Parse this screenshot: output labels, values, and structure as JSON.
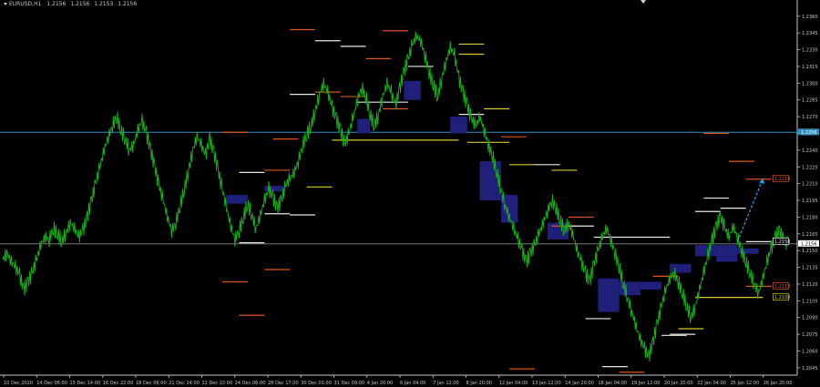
{
  "header": {
    "symbol": "EURUSD,H1",
    "ohlc": [
      "1.2156",
      "1.2156",
      "1.2153",
      "1.2156"
    ]
  },
  "colors": {
    "background": "#000000",
    "price_line": "#17b217",
    "axis_text": "#c8c8c8",
    "zone_fill": "#20207a",
    "level_orange": "#e0531a",
    "level_white": "#e8e8e8",
    "level_yellow": "#d8c828",
    "horizontal_blue": "#2d8fc4",
    "projection": "#2d9ce0"
  },
  "chart_data": {
    "type": "line",
    "series": [
      {
        "values": [
          1.2142,
          1.2148,
          1.214,
          1.2135,
          1.2128,
          1.2115,
          1.2122,
          1.213,
          1.2142,
          1.2155,
          1.2162,
          1.216,
          1.217,
          1.2165,
          1.2158,
          1.2166,
          1.2175,
          1.217,
          1.2162,
          1.2168,
          1.218,
          1.2195,
          1.221,
          1.2225,
          1.224,
          1.2252,
          1.2262,
          1.227,
          1.2258,
          1.225,
          1.224,
          1.2245,
          1.2258,
          1.2266,
          1.2255,
          1.224,
          1.2225,
          1.2208,
          1.2195,
          1.218,
          1.2168,
          1.2175,
          1.219,
          1.2205,
          1.2222,
          1.224,
          1.2252,
          1.2245,
          1.2235,
          1.225,
          1.2238,
          1.2222,
          1.2205,
          1.2188,
          1.2172,
          1.216,
          1.2168,
          1.218,
          1.2192,
          1.2182,
          1.217,
          1.2182,
          1.2195,
          1.2205,
          1.2198,
          1.2188,
          1.2195,
          1.2208,
          1.2215,
          1.222,
          1.223,
          1.2244,
          1.2254,
          1.2262,
          1.2275,
          1.229,
          1.23,
          1.2292,
          1.2278,
          1.2268,
          1.2258,
          1.2245,
          1.2255,
          1.227,
          1.2285,
          1.2296,
          1.2288,
          1.2272,
          1.2262,
          1.2272,
          1.2288,
          1.23,
          1.2292,
          1.228,
          1.2295,
          1.231,
          1.2322,
          1.2335,
          1.2342,
          1.2338,
          1.2325,
          1.231,
          1.2298,
          1.2288,
          1.2305,
          1.232,
          1.2332,
          1.2325,
          1.2305,
          1.2292,
          1.228,
          1.2268,
          1.2262,
          1.227,
          1.2258,
          1.2245,
          1.2235,
          1.222,
          1.2205,
          1.219,
          1.218,
          1.217,
          1.216,
          1.215,
          1.214,
          1.2148,
          1.2155,
          1.2165,
          1.2175,
          1.2185,
          1.2195,
          1.2188,
          1.2178,
          1.2168,
          1.2175,
          1.2165,
          1.215,
          1.214,
          1.213,
          1.2122,
          1.2138,
          1.215,
          1.2162,
          1.217,
          1.216,
          1.2148,
          1.2135,
          1.212,
          1.2108,
          1.2095,
          1.2082,
          1.207,
          1.2062,
          1.2055,
          1.2068,
          1.2085,
          1.21,
          1.2115,
          1.2125,
          1.213,
          1.2122,
          1.2112,
          1.21,
          1.209,
          1.21,
          1.2115,
          1.213,
          1.2145,
          1.216,
          1.2172,
          1.218,
          1.217,
          1.2162,
          1.2172,
          1.2162,
          1.215,
          1.214,
          1.213,
          1.212,
          1.2112,
          1.2125,
          1.214,
          1.2152,
          1.2162,
          1.2168,
          1.2158,
          1.2156
        ]
      }
    ],
    "x_labels": [
      "10 Dec 2020",
      "14 Dec 06:00",
      "15 Dec 14:00",
      "16 Dec 22:00",
      "18 Dec 06:00",
      "21 Dec 14:00",
      "22 Dec 22:00",
      "24 Dec 06:00",
      "28 Dec 17:00",
      "30 Dec 01:00",
      "31 Dec 09:00",
      "4 Jan 20:00",
      "6 Jan 04:00",
      "7 Jan 12:00",
      "8 Jan 20:00",
      "12 Jan 04:00",
      "13 Jan 12:00",
      "14 Jan 20:00",
      "18 Jan 04:00",
      "19 Jan 12:00",
      "20 Jan 20:00",
      "22 Jan 04:00",
      "25 Jan 12:00",
      "26 Jan 20:00"
    ],
    "y_ticks": [
      "1.2360",
      "1.2345",
      "1.2330",
      "1.2315",
      "1.2300",
      "1.2285",
      "1.2270",
      "1.2255",
      "1.2240",
      "1.2225",
      "1.2210",
      "1.2195",
      "1.2180",
      "1.2165",
      "1.2150",
      "1.2135",
      "1.2120",
      "1.2105",
      "1.2090",
      "1.2075",
      "1.2060",
      "1.2045"
    ],
    "ylim": [
      1.204,
      1.2368
    ],
    "grid": false,
    "current_price": "1.2156",
    "blue_level": "1.2256",
    "right_labels": [
      {
        "text": "1.2214",
        "value": 1.2214,
        "color": "#e0531a"
      },
      {
        "text": "1.2158",
        "value": 1.2158,
        "color": "#e8e8e8"
      },
      {
        "text": "1.2118",
        "value": 1.2118,
        "color": "#e0531a"
      },
      {
        "text": "1.2108",
        "value": 1.2108,
        "color": "#d8c828"
      }
    ],
    "zones": [
      {
        "i0": 53,
        "i1": 58,
        "lo": 1.2192,
        "hi": 1.22
      },
      {
        "i0": 62,
        "i1": 67,
        "lo": 1.2203,
        "hi": 1.2208
      },
      {
        "i0": 84,
        "i1": 87,
        "lo": 1.2255,
        "hi": 1.2268
      },
      {
        "i0": 95,
        "i1": 99,
        "lo": 1.2285,
        "hi": 1.2302
      },
      {
        "i0": 106,
        "i1": 110,
        "lo": 1.2255,
        "hi": 1.227
      },
      {
        "i0": 113,
        "i1": 118,
        "lo": 1.2195,
        "hi": 1.223
      },
      {
        "i0": 118,
        "i1": 122,
        "lo": 1.2175,
        "hi": 1.22
      },
      {
        "i0": 129,
        "i1": 134,
        "lo": 1.216,
        "hi": 1.2175
      },
      {
        "i0": 141,
        "i1": 146,
        "lo": 1.2095,
        "hi": 1.2125
      },
      {
        "i0": 146,
        "i1": 151,
        "lo": 1.211,
        "hi": 1.2122
      },
      {
        "i0": 151,
        "i1": 156,
        "lo": 1.2115,
        "hi": 1.2122
      },
      {
        "i0": 158,
        "i1": 163,
        "lo": 1.213,
        "hi": 1.2138
      },
      {
        "i0": 164,
        "i1": 169,
        "lo": 1.2145,
        "hi": 1.2155
      },
      {
        "i0": 169,
        "i1": 174,
        "lo": 1.214,
        "hi": 1.2155
      },
      {
        "i0": 174,
        "i1": 179,
        "lo": 1.2147,
        "hi": 1.2152
      }
    ],
    "levels": [
      {
        "i0": 68,
        "i1": 74,
        "v": 1.2348,
        "c": "o"
      },
      {
        "i0": 74,
        "i1": 80,
        "v": 1.2338,
        "c": "w"
      },
      {
        "i0": 80,
        "i1": 86,
        "v": 1.2333,
        "c": "w"
      },
      {
        "i0": 86,
        "i1": 92,
        "v": 1.2322,
        "c": "o"
      },
      {
        "i0": 90,
        "i1": 96,
        "v": 1.2347,
        "c": "o"
      },
      {
        "i0": 96,
        "i1": 102,
        "v": 1.2315,
        "c": "w"
      },
      {
        "i0": 108,
        "i1": 114,
        "v": 1.2335,
        "c": "y"
      },
      {
        "i0": 108,
        "i1": 114,
        "v": 1.2326,
        "c": "y"
      },
      {
        "i0": 68,
        "i1": 74,
        "v": 1.229,
        "c": "w"
      },
      {
        "i0": 74,
        "i1": 80,
        "v": 1.2292,
        "c": "o"
      },
      {
        "i0": 80,
        "i1": 86,
        "v": 1.2288,
        "c": "o"
      },
      {
        "i0": 84,
        "i1": 90,
        "v": 1.2283,
        "c": "w"
      },
      {
        "i0": 90,
        "i1": 96,
        "v": 1.2283,
        "c": "w"
      },
      {
        "i0": 90,
        "i1": 96,
        "v": 1.2277,
        "c": "o"
      },
      {
        "i0": 108,
        "i1": 114,
        "v": 1.2272,
        "c": "w"
      },
      {
        "i0": 114,
        "i1": 120,
        "v": 1.2277,
        "c": "y"
      },
      {
        "i0": 52,
        "i1": 58,
        "v": 1.2256,
        "c": "o"
      },
      {
        "i0": 64,
        "i1": 70,
        "v": 1.225,
        "c": "o"
      },
      {
        "i0": 78,
        "i1": 96,
        "v": 1.2249,
        "c": "y"
      },
      {
        "i0": 96,
        "i1": 108,
        "v": 1.2249,
        "c": "y"
      },
      {
        "i0": 110,
        "i1": 120,
        "v": 1.2247,
        "c": "y"
      },
      {
        "i0": 118,
        "i1": 124,
        "v": 1.2252,
        "c": "o"
      },
      {
        "i0": 120,
        "i1": 126,
        "v": 1.2227,
        "c": "y"
      },
      {
        "i0": 126,
        "i1": 132,
        "v": 1.2227,
        "c": "w"
      },
      {
        "i0": 130,
        "i1": 136,
        "v": 1.2222,
        "c": "y"
      },
      {
        "i0": 56,
        "i1": 62,
        "v": 1.222,
        "c": "w"
      },
      {
        "i0": 62,
        "i1": 68,
        "v": 1.2222,
        "c": "o"
      },
      {
        "i0": 72,
        "i1": 78,
        "v": 1.2207,
        "c": "y"
      },
      {
        "i0": 62,
        "i1": 68,
        "v": 1.2183,
        "c": "w"
      },
      {
        "i0": 68,
        "i1": 74,
        "v": 1.2182,
        "c": "w"
      },
      {
        "i0": 56,
        "i1": 62,
        "v": 1.2157,
        "c": "w"
      },
      {
        "i0": 62,
        "i1": 68,
        "v": 1.2133,
        "c": "o"
      },
      {
        "i0": 52,
        "i1": 58,
        "v": 1.2122,
        "c": "o"
      },
      {
        "i0": 56,
        "i1": 62,
        "v": 1.2092,
        "c": "o"
      },
      {
        "i0": 130,
        "i1": 136,
        "v": 1.2172,
        "c": "o"
      },
      {
        "i0": 134,
        "i1": 140,
        "v": 1.2172,
        "c": "w"
      },
      {
        "i0": 134,
        "i1": 140,
        "v": 1.218,
        "c": "o"
      },
      {
        "i0": 138,
        "i1": 144,
        "v": 1.2089,
        "c": "w"
      },
      {
        "i0": 140,
        "i1": 146,
        "v": 1.2162,
        "c": "w"
      },
      {
        "i0": 146,
        "i1": 152,
        "v": 1.2162,
        "c": "w"
      },
      {
        "i0": 152,
        "i1": 158,
        "v": 1.2162,
        "c": "w"
      },
      {
        "i0": 154,
        "i1": 160,
        "v": 1.2127,
        "c": "o"
      },
      {
        "i0": 156,
        "i1": 162,
        "v": 1.2074,
        "c": "w"
      },
      {
        "i0": 158,
        "i1": 164,
        "v": 1.2075,
        "c": "w"
      },
      {
        "i0": 160,
        "i1": 166,
        "v": 1.208,
        "c": "y"
      },
      {
        "i0": 164,
        "i1": 170,
        "v": 1.2185,
        "c": "w"
      },
      {
        "i0": 166,
        "i1": 172,
        "v": 1.2197,
        "c": "w"
      },
      {
        "i0": 170,
        "i1": 176,
        "v": 1.2188,
        "c": "w"
      },
      {
        "i0": 166,
        "i1": 172,
        "v": 1.2255,
        "c": "o"
      },
      {
        "i0": 172,
        "i1": 178,
        "v": 1.223,
        "c": "o"
      },
      {
        "i0": 176,
        "i1": 182,
        "v": 1.2214,
        "c": "o"
      },
      {
        "i0": 176,
        "i1": 182,
        "v": 1.2158,
        "c": "w"
      },
      {
        "i0": 176,
        "i1": 182,
        "v": 1.2118,
        "c": "o"
      },
      {
        "i0": 164,
        "i1": 180,
        "v": 1.2108,
        "c": "y"
      },
      {
        "i0": 120,
        "i1": 126,
        "v": 1.2044,
        "c": "o"
      },
      {
        "i0": 142,
        "i1": 148,
        "v": 1.2046,
        "c": "w"
      },
      {
        "i0": 146,
        "i1": 152,
        "v": 1.2041,
        "c": "o"
      }
    ],
    "projection": {
      "from_index": 174,
      "from": 1.2158,
      "to_index": 180,
      "to": 1.2214
    }
  }
}
